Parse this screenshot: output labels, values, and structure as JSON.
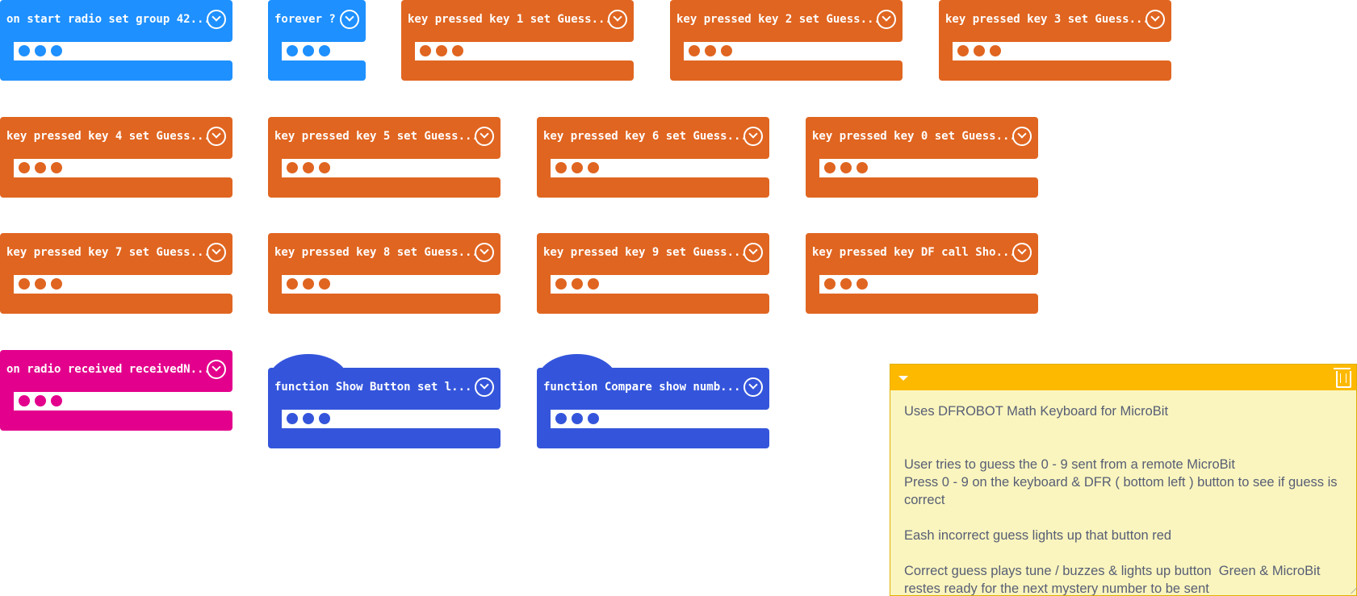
{
  "blocks": [
    {
      "label": "on start radio set group 42...",
      "color": "#1E90FF",
      "kind": "event"
    },
    {
      "label": "forever ?",
      "color": "#1E90FF",
      "kind": "event"
    },
    {
      "label": "key pressed key 1 set Guess...",
      "color": "#E06520",
      "kind": "event"
    },
    {
      "label": "key pressed key 2 set Guess...",
      "color": "#E06520",
      "kind": "event"
    },
    {
      "label": "key pressed key 3 set Guess...",
      "color": "#E06520",
      "kind": "event"
    },
    {
      "label": "key pressed key 4 set Guess...",
      "color": "#E06520",
      "kind": "event"
    },
    {
      "label": "key pressed key 5 set Guess...",
      "color": "#E06520",
      "kind": "event"
    },
    {
      "label": "key pressed key 6 set Guess...",
      "color": "#E06520",
      "kind": "event"
    },
    {
      "label": "key pressed key 0 set Guess...",
      "color": "#E06520",
      "kind": "event"
    },
    {
      "label": "key pressed key 7 set Guess...",
      "color": "#E06520",
      "kind": "event"
    },
    {
      "label": "key pressed key 8 set Guess...",
      "color": "#E06520",
      "kind": "event"
    },
    {
      "label": "key pressed key 9 set Guess...",
      "color": "#E06520",
      "kind": "event"
    },
    {
      "label": "key pressed key DF call Sho...",
      "color": "#E06520",
      "kind": "event"
    },
    {
      "label": "on radio received receivedN...",
      "color": "#E3008C",
      "kind": "event"
    },
    {
      "label": "function Show Button  set l...",
      "color": "#3455DB",
      "kind": "function"
    },
    {
      "label": "function Compare  show numb...",
      "color": "#3455DB",
      "kind": "function"
    }
  ],
  "comment": {
    "header_color": "#FDB900",
    "text": "Uses DFROBOT Math Keyboard for MicroBit\n\n\nUser tries to guess the 0 - 9 sent from a remote MicroBit\nPress 0 - 9 on the keyboard & DFR ( bottom left ) button to see if guess is correct\n\nEash incorrect guess lights up that button red\n\nCorrect guess plays tune / buzzes & lights up button  Green & MicroBit restes ready for the next mystery number to be sent"
  }
}
